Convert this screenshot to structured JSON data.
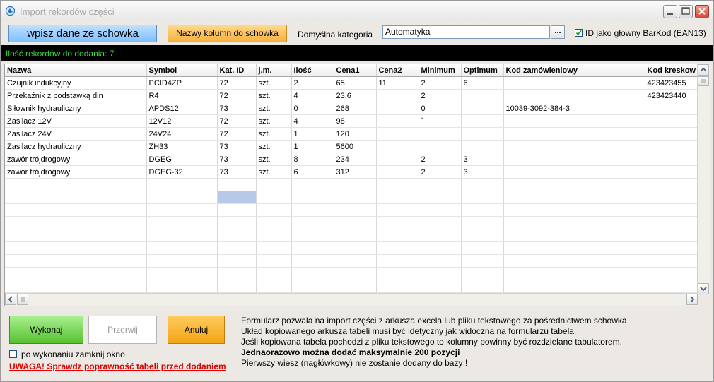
{
  "window": {
    "title": "Import rekordów części"
  },
  "toolbar": {
    "paste_button": "wpisz dane ze schowka",
    "columns_button": "Nazwy kolumn do schowka",
    "category_label": "Domyślna kategoria",
    "category_value": "Automatyka",
    "browse_button": "...",
    "ean_checkbox_label": "ID jako głowny BarKod (EAN13)",
    "ean_checked": true
  },
  "status": {
    "text": "Ilość rekordów do dodania: 7"
  },
  "table": {
    "columns": [
      "Nazwa",
      "Symbol",
      "Kat. ID",
      "j.m.",
      "Ilość",
      "Cena1",
      "Cena2",
      "Minimum",
      "Optimum",
      "Kod zamówieniowy",
      "Kod kreskow"
    ],
    "rows": [
      [
        "Czujnik indukcyjny",
        "PCID4ZP",
        "72",
        "szt.",
        "2",
        "65",
        "11",
        "2",
        "6",
        "",
        "423423455"
      ],
      [
        "Przekaźnik z podstawką din",
        "R4",
        "72",
        "szt.",
        "4",
        "23.6",
        "",
        "2",
        "",
        "",
        "423423440"
      ],
      [
        "Siłownik hydrauliczny",
        "APDS12",
        "73",
        "szt.",
        "0",
        "268",
        "",
        "0",
        "",
        "10039-3092-384-3",
        ""
      ],
      [
        "Zasilacz 12V",
        "12V12",
        "72",
        "szt.",
        "4",
        "98",
        "",
        "`",
        "",
        "",
        ""
      ],
      [
        "Zasilacz 24V",
        "24V24",
        "72",
        "szt.",
        "1",
        "120",
        "",
        "",
        "",
        "",
        ""
      ],
      [
        "Zasilacz hydrauliczny",
        "ZH33",
        "73",
        "szt.",
        "1",
        "5600",
        "",
        "",
        "",
        "",
        ""
      ],
      [
        "zawór trójdrogowy",
        "DGEG",
        "73",
        "szt.",
        "8",
        "234",
        "",
        "2",
        "3",
        "",
        ""
      ],
      [
        "zawór trójdrogowy",
        "DGEG-32",
        "73",
        "szt.",
        "6",
        "312",
        "",
        "2",
        "3",
        "",
        ""
      ]
    ],
    "selected_cell": {
      "row": 9,
      "column": 2
    }
  },
  "actions": {
    "run_button": "Wykonaj",
    "stop_button": "Przerwij",
    "cancel_button": "Anuluj",
    "close_after_label": "po wykonaniu zamknij okno",
    "close_after_checked": false,
    "warning": "UWAGA! Sprawdz poprawność tabeli przed dodaniem"
  },
  "info": {
    "line1": "Formularz pozwala na import części z arkusza excela lub pliku tekstowego za pośrednictwem schowka",
    "line2": "Układ kopiowanego arkusza tabeli musi być idetyczny jak widoczna na formularzu tabela.",
    "line3": "Jeśli kopiowana tabela pochodzi z pliku tekstowego to kolumny powinny być rozdzielane tabulatorem.",
    "line4": "Jednaorazowo można dodać maksymalnie 200 pozycji",
    "line5": "Pierwszy wiesz (nagłówkowy) nie zostanie dodany do bazy !"
  },
  "colors": {
    "status_background": "#000000",
    "status_text": "#39d239",
    "paste_button": "#7fbfff",
    "columns_button": "#f6b13e",
    "run_button": "#56c12f",
    "cancel_button": "#f3a514",
    "warning": "#e10000",
    "selected_cell": "#b7c9e6"
  }
}
